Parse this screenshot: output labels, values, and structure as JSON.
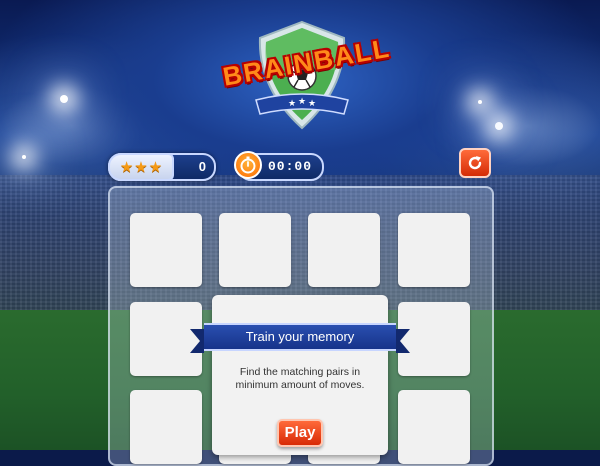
{
  "game": {
    "logo_text": "BRAINBALL"
  },
  "hud": {
    "stars_earned": 3,
    "score": "0",
    "timer": "00:00"
  },
  "icons": {
    "stopwatch": "stopwatch-icon",
    "restart": "restart-icon",
    "star": "star-icon"
  },
  "board": {
    "rows": 3,
    "columns": 4
  },
  "dialog": {
    "title": "Train your memory",
    "description": "Find the matching pairs in minimum amount of moves.",
    "play_label": "Play"
  },
  "colors": {
    "accent_orange": "#ff6a3a",
    "banner_blue": "#1f43a0",
    "shield_green": "#4caf50"
  }
}
